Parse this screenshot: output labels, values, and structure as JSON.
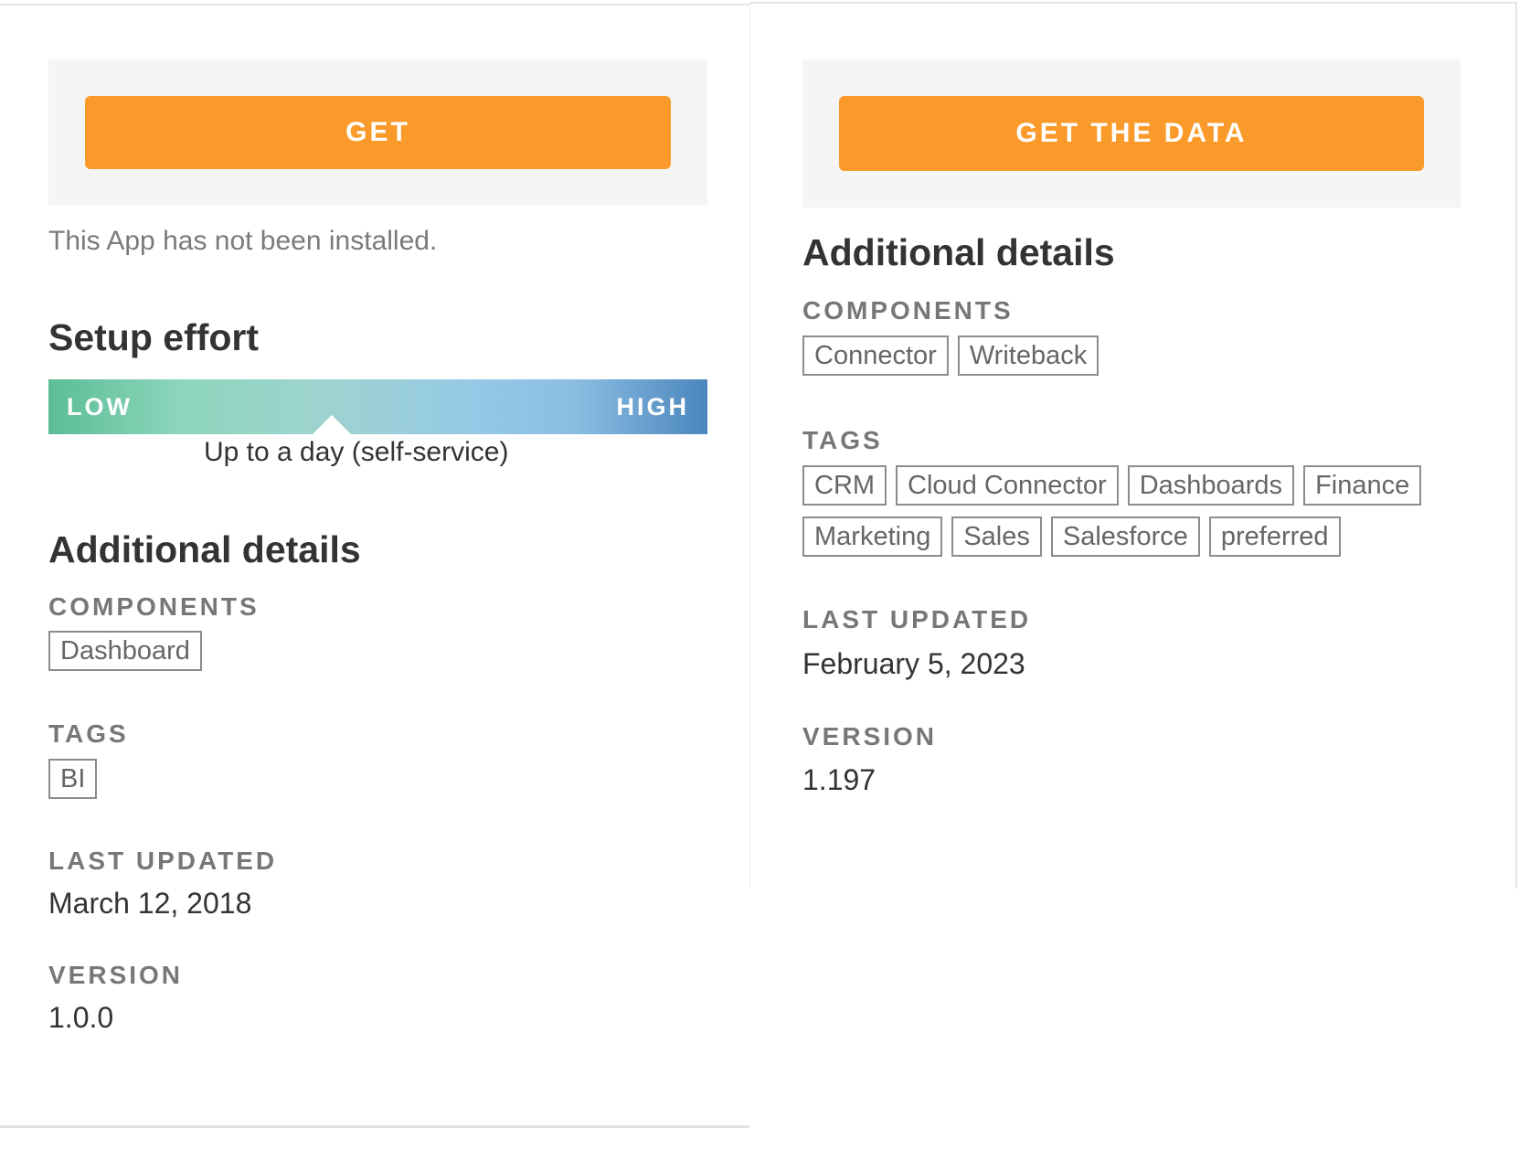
{
  "left_panel": {
    "get_button": "GET",
    "install_status": "This App has not been installed.",
    "setup_effort": {
      "heading": "Setup effort",
      "low_label": "LOW",
      "high_label": "HIGH",
      "level_fraction": 0.43,
      "caption": "Up to a day (self-service)"
    },
    "details_heading": "Additional details",
    "components_label": "COMPONENTS",
    "components": [
      "Dashboard"
    ],
    "tags_label": "TAGS",
    "tags": [
      "BI"
    ],
    "last_updated_label": "LAST UPDATED",
    "last_updated": "March 12, 2018",
    "version_label": "VERSION",
    "version": "1.0.0"
  },
  "right_panel": {
    "get_button": "GET THE DATA",
    "details_heading": "Additional details",
    "components_label": "COMPONENTS",
    "components": [
      "Connector",
      "Writeback"
    ],
    "tags_label": "TAGS",
    "tags": [
      "CRM",
      "Cloud Connector",
      "Dashboards",
      "Finance",
      "Marketing",
      "Sales",
      "Salesforce",
      "preferred"
    ],
    "last_updated_label": "LAST UPDATED",
    "last_updated": "February 5, 2023",
    "version_label": "VERSION",
    "version": "1.197"
  },
  "colors": {
    "accent": "#fa9a2a",
    "cta_background": "#f5f5f5",
    "chip_border": "#8c8c8c"
  }
}
